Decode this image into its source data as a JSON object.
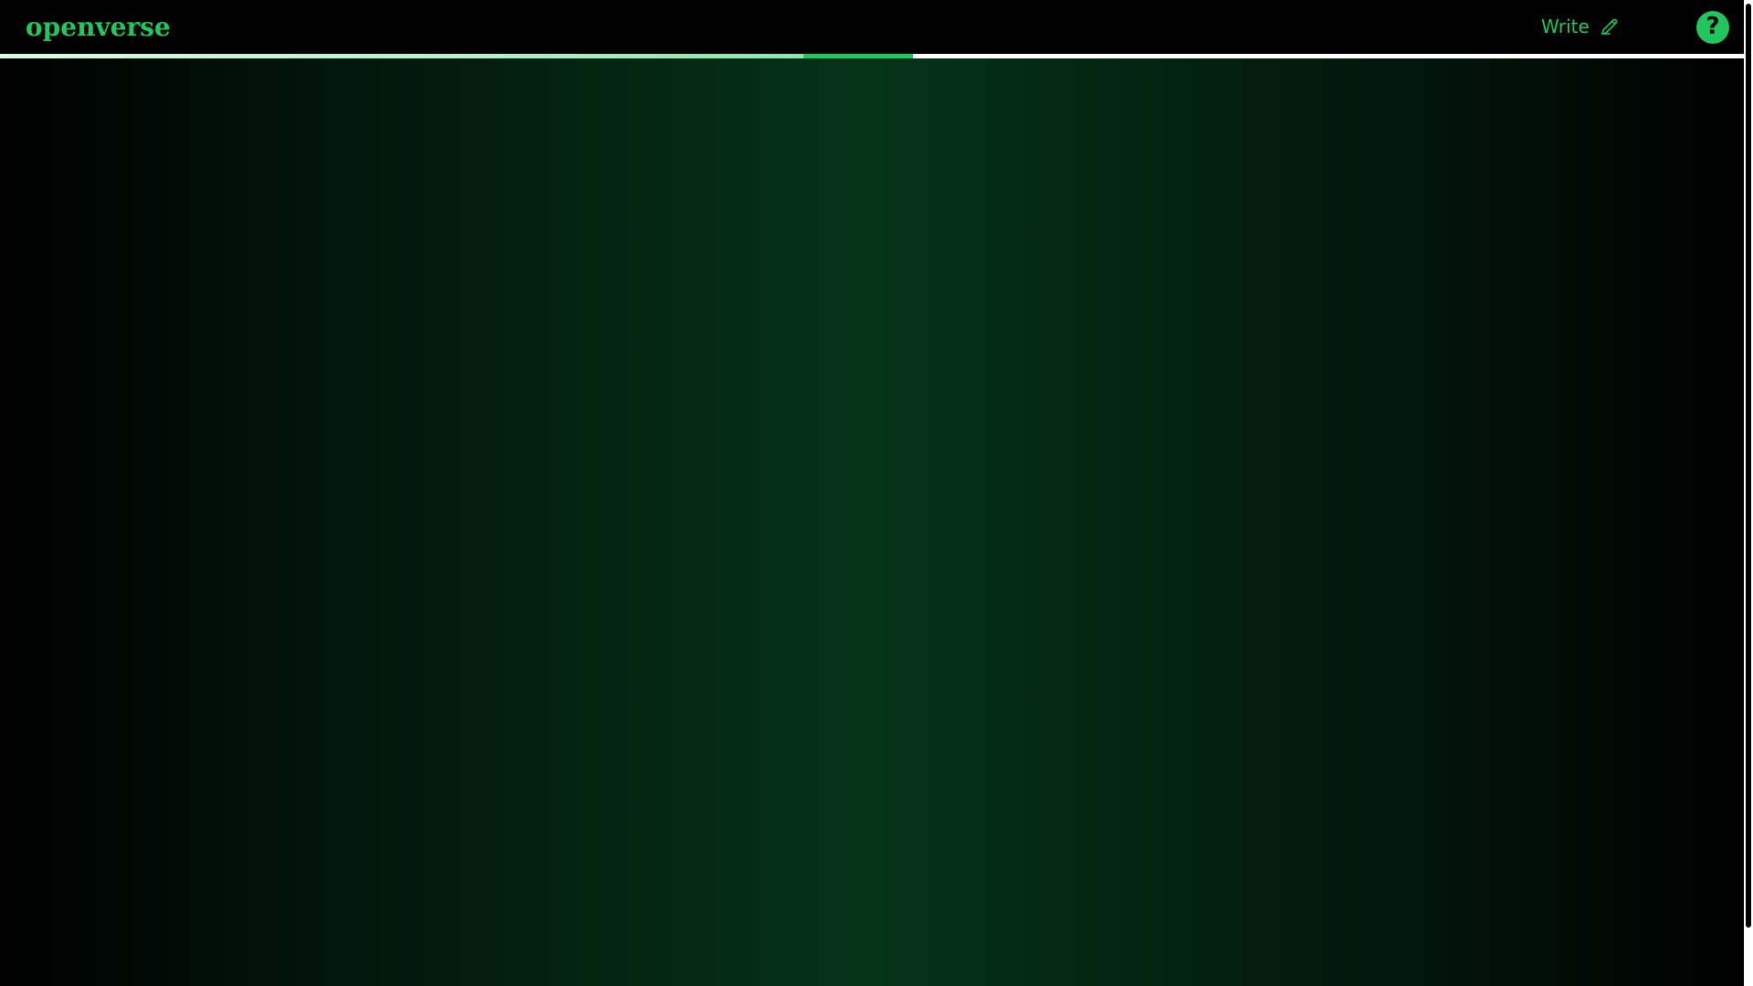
{
  "header": {
    "logo_text": "openverse",
    "write_label": "Write",
    "write_icon": "pencil-icon",
    "help_icon": "help-icon",
    "help_glyph": "?"
  },
  "progress": {
    "value": 0.5
  },
  "colors": {
    "accent": "#22c55e",
    "background": "#000000",
    "content_center": "#053419",
    "progress_track": "#ffffff",
    "progress_left": "#b9f1cc"
  }
}
